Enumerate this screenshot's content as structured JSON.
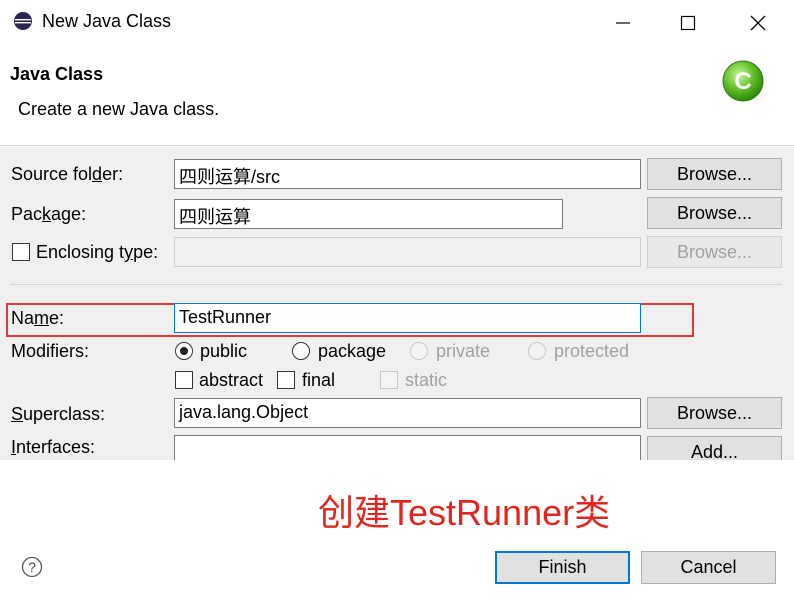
{
  "window": {
    "title": "New Java Class",
    "icon": "eclipse-icon"
  },
  "header": {
    "title": "Java Class",
    "description": "Create a new Java class.",
    "logo": "new-class-c-icon"
  },
  "form": {
    "source_folder": {
      "label_pre": "Source fol",
      "label_mn": "d",
      "label_post": "er:",
      "value": "四则运算/src",
      "button": "Browse..."
    },
    "package": {
      "label_pre": "Pac",
      "label_mn": "k",
      "label_post": "age:",
      "value": "四则运算",
      "button": "Browse..."
    },
    "enclosing_type": {
      "label_pre": "Enclosing t",
      "label_mn": "y",
      "label_post": "pe:",
      "value": "",
      "button": "Browse..."
    },
    "name": {
      "label_pre": "Na",
      "label_mn": "m",
      "label_post": "e:",
      "value": "TestRunner"
    },
    "modifiers": {
      "label": "Modifiers:",
      "public": "public",
      "package": "package",
      "private": "private",
      "protected": "protected",
      "abstract": "abstract",
      "final": "final",
      "static": "static"
    },
    "superclass": {
      "label_pre": "",
      "label_mn": "S",
      "label_post": "uperclass:",
      "value": "java.lang.Object",
      "button": "Browse..."
    },
    "interfaces": {
      "label_pre": "",
      "label_mn": "I",
      "label_post": "nterfaces:",
      "button": "Add..."
    }
  },
  "annotation": "创建TestRunner类",
  "footer": {
    "finish": "Finish",
    "cancel": "Cancel"
  },
  "colors": {
    "highlight": "#e03a3a",
    "annotation": "#e0261f",
    "default_button_border": "#0078d7",
    "logo_green": "#4caf1e"
  }
}
